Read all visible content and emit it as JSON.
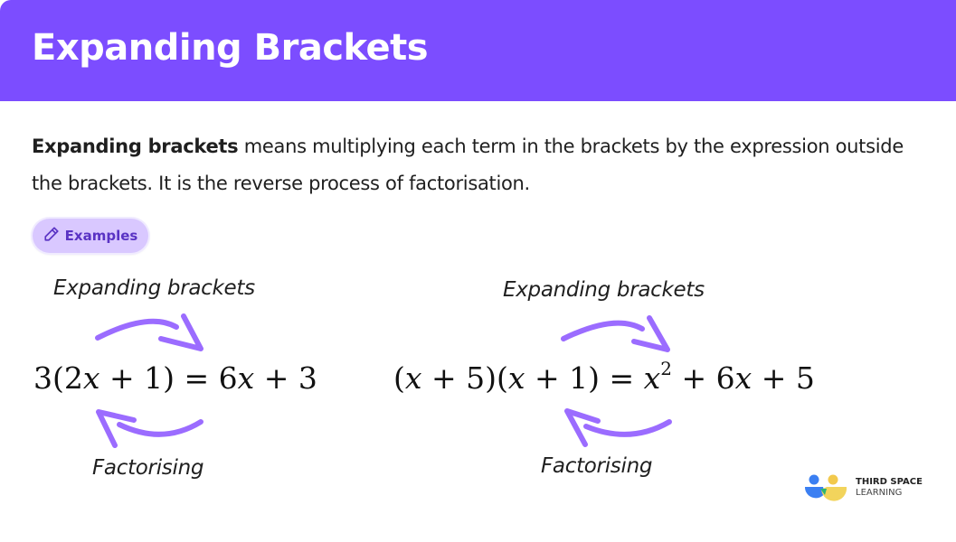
{
  "header": {
    "title": "Expanding Brackets",
    "background_color": "#7c4dff"
  },
  "intro": {
    "bold_term": "Expanding brackets",
    "text": " means multiplying each term in the brackets by the expression outside the brackets. It is the reverse process of factorisation."
  },
  "examples_badge": {
    "label": "Examples",
    "icon": "pencil-icon"
  },
  "diagrams": [
    {
      "top_label": "Expanding brackets",
      "bottom_label": "Factorising",
      "equation_lhs": "3(2x + 1)",
      "equation_rhs": "6x + 3"
    },
    {
      "top_label": "Expanding brackets",
      "bottom_label": "Factorising",
      "equation_lhs": "(x + 5)(x + 1)",
      "equation_rhs": "x² + 6x + 5"
    }
  ],
  "arrow_color": "#9b6cff",
  "logo": {
    "line1": "THIRD SPACE",
    "line2": "LEARNING"
  }
}
